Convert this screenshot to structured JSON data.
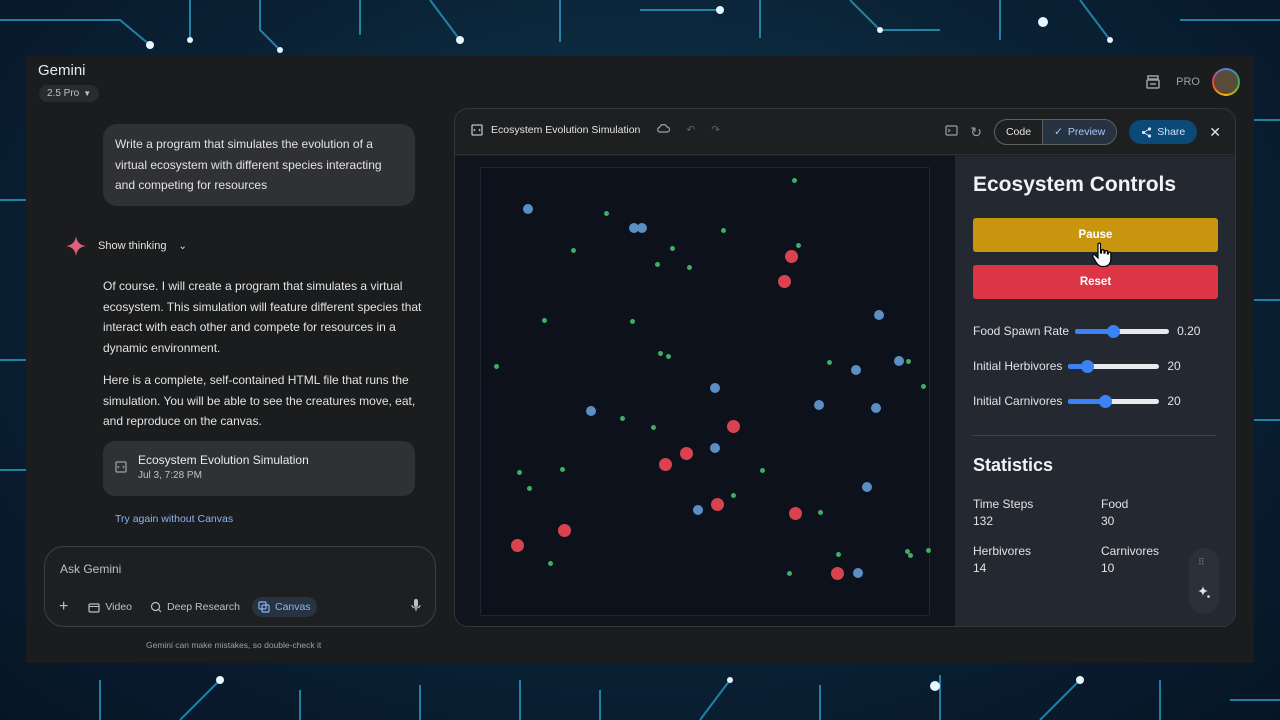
{
  "app": {
    "title": "Gemini",
    "model": "2.5 Pro",
    "badge": "PRO"
  },
  "chat": {
    "user_message": "Write a program that simulates the evolution of a virtual ecosystem with different species interacting and competing for resources",
    "show_thinking": "Show thinking",
    "response_p1": "Of course. I will create a program that simulates a virtual ecosystem. This simulation will feature different species that interact with each other and compete for resources in a dynamic environment.",
    "response_p2": "Here is a complete, self-contained HTML file that runs the simulation. You will be able to see the creatures move, eat, and reproduce on the canvas.",
    "canvas_card": {
      "title": "Ecosystem Evolution Simulation",
      "subtitle": "Jul 3, 7:28 PM"
    },
    "try_again": "Try again without Canvas"
  },
  "input": {
    "placeholder": "Ask Gemini",
    "tools": [
      "Video",
      "Deep Research",
      "Canvas"
    ],
    "active_tool": "Canvas",
    "disclaimer": "Gemini can make mistakes, so double-check it"
  },
  "panel": {
    "title": "Ecosystem Evolution Simulation",
    "code_label": "Code",
    "preview_label": "Preview",
    "share_label": "Share"
  },
  "controls": {
    "title": "Ecosystem Controls",
    "pause_label": "Pause",
    "reset_label": "Reset",
    "sliders": [
      {
        "label": "Food Spawn Rate",
        "value": "0.20",
        "fraction": 0.4
      },
      {
        "label": "Initial Herbivores",
        "value": "20",
        "fraction": 0.2
      },
      {
        "label": "Initial Carnivores",
        "value": "20",
        "fraction": 0.4
      }
    ],
    "stats_title": "Statistics",
    "stats": [
      {
        "label": "Time Steps",
        "value": "132"
      },
      {
        "label": "Food",
        "value": "30"
      },
      {
        "label": "Herbivores",
        "value": "14"
      },
      {
        "label": "Carnivores",
        "value": "10"
      }
    ]
  },
  "colors": {
    "pause": "#c8950e",
    "reset": "#dc3545",
    "slider": "#3b82f6",
    "food": "#3fae63",
    "herbivore": "#5b8fc4",
    "carnivore": "#d8434f"
  }
}
